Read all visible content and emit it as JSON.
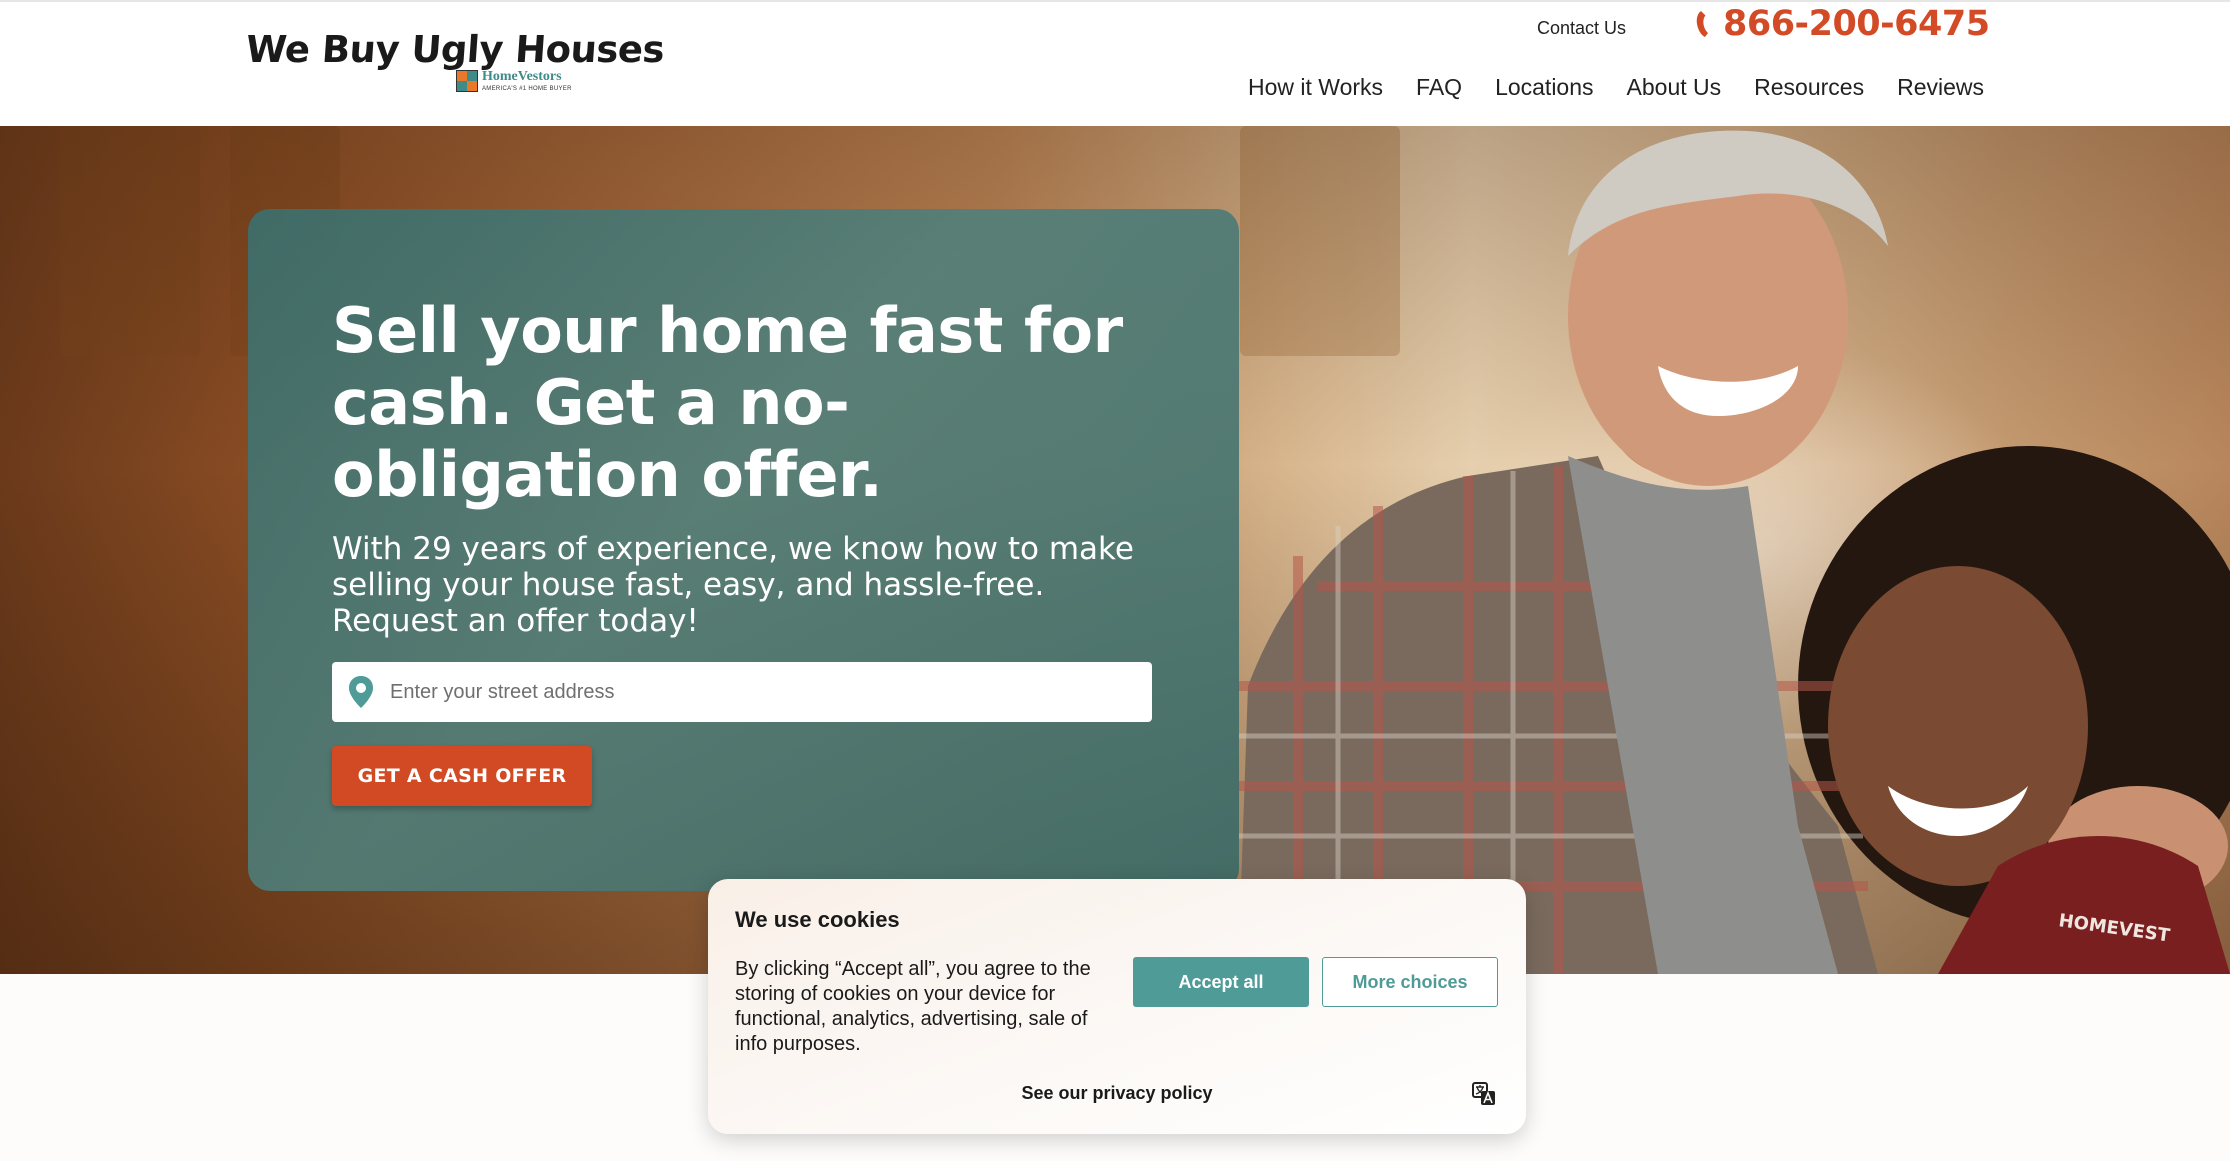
{
  "header": {
    "logo": {
      "main": "We Buy Ugly Houses",
      "brand": "HomeVestors",
      "tagline": "AMERICA'S #1 HOME BUYER"
    },
    "contact_label": "Contact Us",
    "phone": "866-200-6475",
    "nav": [
      "How it Works",
      "FAQ",
      "Locations",
      "About Us",
      "Resources",
      "Reviews"
    ]
  },
  "hero": {
    "title": "Sell your home fast for cash. Get a no-obligation offer.",
    "subtitle": "With 29 years of experience, we know how to make selling your house fast, easy, and hassle-free. Request an offer today!",
    "address_placeholder": "Enter your street address",
    "cta_label": "GET A CASH OFFER"
  },
  "cookie_banner": {
    "title": "We use cookies",
    "text": "By clicking “Accept all”, you agree to the storing of cookies on your device for functional, analytics, advertising, sale of info purposes.",
    "accept_label": "Accept all",
    "more_label": "More choices",
    "privacy_label": "See our privacy policy"
  },
  "colors": {
    "brand_orange": "#d14a24",
    "teal": "#4e9b97",
    "hero_card": "#3f6f6c"
  },
  "icons": [
    "phone-icon",
    "location-pin-icon",
    "language-icon"
  ]
}
